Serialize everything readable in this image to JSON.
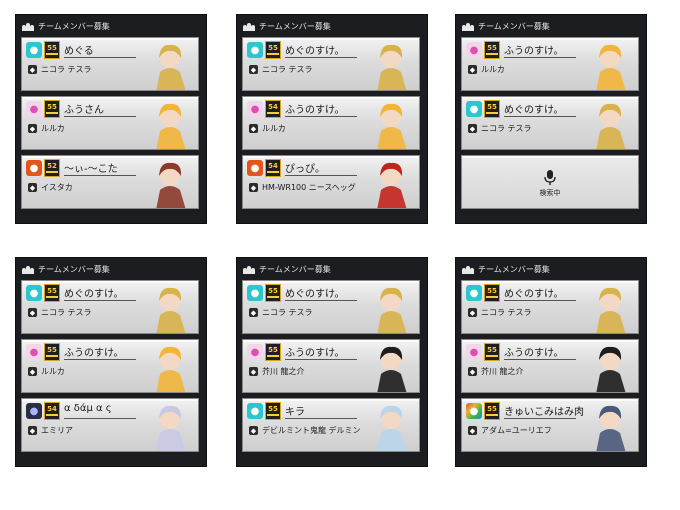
{
  "header_title": "チームメンバー募集",
  "searching_label": "検索中",
  "panels": [
    {
      "slots": [
        {
          "player": "めぐる",
          "character": "ニコラ テスラ",
          "rank_color": "cyan",
          "level": "55",
          "char_color": "#d8b24a"
        },
        {
          "player": "ふうさん",
          "character": "ルルカ",
          "rank_color": "pink",
          "level": "55",
          "char_color": "#f2b53a"
        },
        {
          "player": "〜ぃ-〜こた",
          "character": "イスタカ",
          "rank_color": "orange",
          "level": "52",
          "char_color": "#8c3a2a"
        }
      ]
    },
    {
      "slots": [
        {
          "player": "めぐのすけ。",
          "character": "ニコラ テスラ",
          "rank_color": "cyan",
          "level": "55",
          "char_color": "#d8b24a"
        },
        {
          "player": "ふうのすけ。",
          "character": "ルルカ",
          "rank_color": "pink",
          "level": "54",
          "char_color": "#f2b53a"
        },
        {
          "player": "ぴっぴ。",
          "character": "HM-WR100 ニースヘッグ",
          "rank_color": "orange",
          "level": "54",
          "char_color": "#c4231d"
        }
      ]
    },
    {
      "slots": [
        {
          "player": "ふうのすけ。",
          "character": "ルルカ",
          "rank_color": "pink",
          "level": "55",
          "char_color": "#f2b53a"
        },
        {
          "player": "めぐのすけ。",
          "character": "ニコラ テスラ",
          "rank_color": "cyan",
          "level": "55",
          "char_color": "#d8b24a"
        },
        {
          "empty": true
        }
      ]
    },
    {
      "slots": [
        {
          "player": "めぐのすけ。",
          "character": "ニコラ テスラ",
          "rank_color": "cyan",
          "level": "55",
          "char_color": "#d8b24a"
        },
        {
          "player": "ふうのすけ。",
          "character": "ルルカ",
          "rank_color": "pink",
          "level": "55",
          "char_color": "#f2b53a"
        },
        {
          "player": "α δάμ α ς",
          "character": "エミリア",
          "rank_color": "dark",
          "level": "54",
          "char_color": "#c9c9e6"
        }
      ]
    },
    {
      "slots": [
        {
          "player": "めぐのすけ。",
          "character": "ニコラ テスラ",
          "rank_color": "cyan",
          "level": "55",
          "char_color": "#d8b24a"
        },
        {
          "player": "ふうのすけ。",
          "character": "芥川 龍之介",
          "rank_color": "pink",
          "level": "55",
          "char_color": "#1d1d1d"
        },
        {
          "player": "キラ",
          "character": "デビルミント鬼龍 デルミン",
          "rank_color": "cyan",
          "level": "55",
          "char_color": "#b9d5ea"
        }
      ]
    },
    {
      "slots": [
        {
          "player": "めぐのすけ。",
          "character": "ニコラ テスラ",
          "rank_color": "cyan",
          "level": "55",
          "char_color": "#d8b24a"
        },
        {
          "player": "ふうのすけ。",
          "character": "芥川 龍之介",
          "rank_color": "pink",
          "level": "55",
          "char_color": "#1d1d1d"
        },
        {
          "player": "きゅいこみはみ肉",
          "character": "アダム=ユーリエフ",
          "rank_color": "multi",
          "level": "55",
          "char_color": "#4a5a7a"
        }
      ]
    }
  ]
}
